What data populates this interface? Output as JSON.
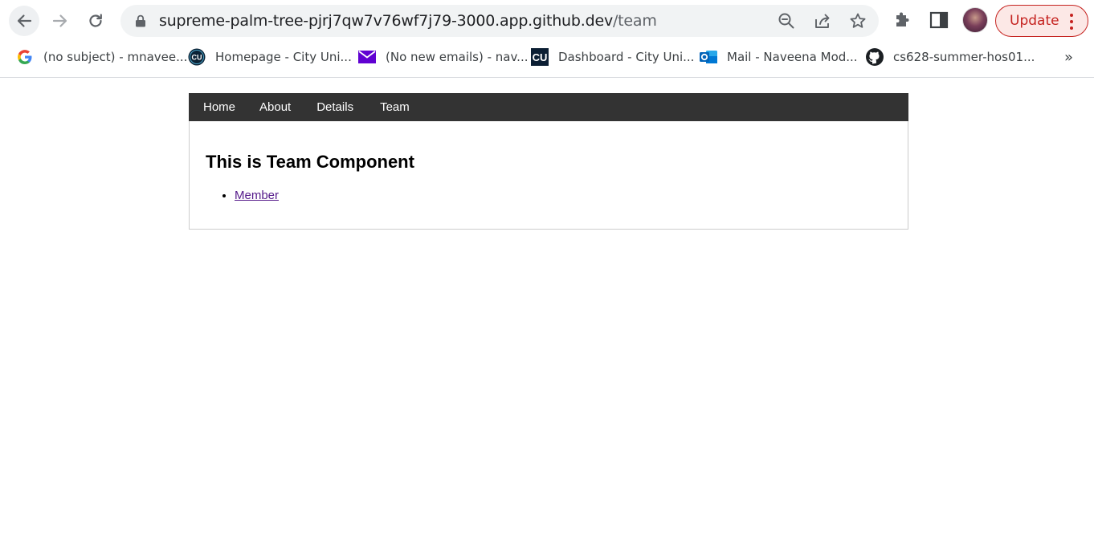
{
  "browser": {
    "url_host": "supreme-palm-tree-pjrj7qw7v76wf7j79-3000.app.github.dev",
    "url_path": "/team",
    "update_label": "Update",
    "icons": {
      "back": "back-arrow-icon",
      "forward": "forward-arrow-icon",
      "reload": "reload-icon",
      "lock": "lock-icon",
      "zoom": "zoom-out-icon",
      "share": "share-icon",
      "bookmark": "star-icon",
      "extensions": "puzzle-icon",
      "side_panel": "side-panel-icon",
      "menu": "kebab-menu-icon"
    },
    "colors": {
      "update_accent": "#c5221f",
      "update_bg": "#fce8e6"
    }
  },
  "bookmarks": {
    "items": [
      {
        "label": "(no subject) - mnavee...",
        "icon": "google-icon"
      },
      {
        "label": "Homepage - City Uni...",
        "icon": "city-university-icon"
      },
      {
        "label": "(No new emails) - nav...",
        "icon": "mail-icon"
      },
      {
        "label": "Dashboard - City Uni...",
        "icon": "cu-dashboard-icon"
      },
      {
        "label": "Mail - Naveena Mod...",
        "icon": "outlook-icon"
      },
      {
        "label": "cs628-summer-hos01...",
        "icon": "github-icon"
      }
    ],
    "more": "»"
  },
  "page": {
    "nav": {
      "items": [
        "Home",
        "About",
        "Details",
        "Team"
      ]
    },
    "heading": "This is Team Component",
    "list": [
      "Member"
    ],
    "colors": {
      "navbar_bg": "#333333",
      "link_visited": "#551a8b"
    }
  }
}
